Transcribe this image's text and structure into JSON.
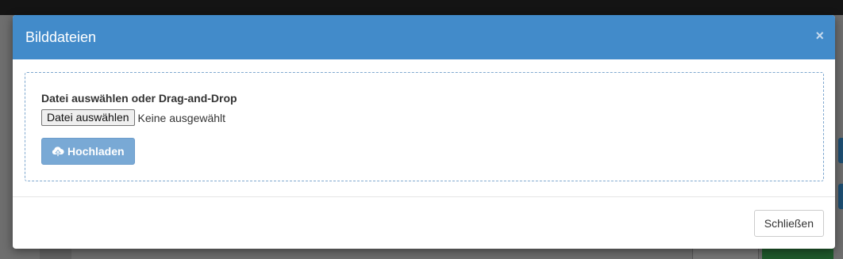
{
  "modal": {
    "title": "Bilddateien",
    "close_symbol": "×",
    "dropzone_label": "Datei auswählen oder Drag-and-Drop",
    "file_button_label": "Datei auswählen",
    "file_status": "Keine ausgewählt",
    "upload_button_label": "Hochladen",
    "upload_icon": "cloud-upload-icon",
    "footer_close_label": "Schließen"
  },
  "colors": {
    "header": "#428bca",
    "upload_button": "#79a9d5",
    "dropzone_border": "#7fa8cf"
  }
}
